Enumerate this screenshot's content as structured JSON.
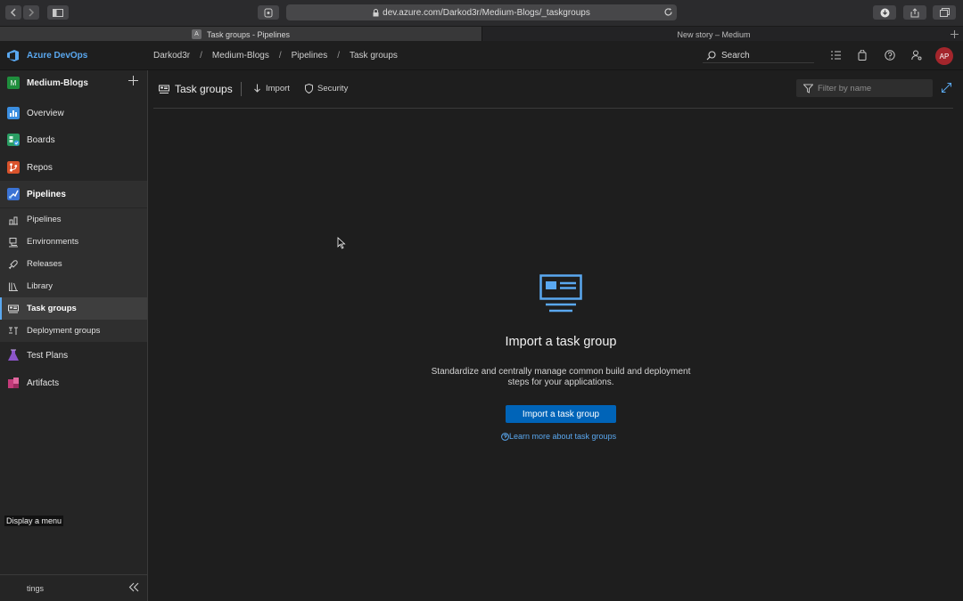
{
  "browser": {
    "url": "dev.azure.com/Darkod3r/Medium-Blogs/_taskgroups",
    "tabs": [
      {
        "label": "Task groups - Pipelines",
        "favicon_letter": "A",
        "active": true
      },
      {
        "label": "New story – Medium",
        "active": false
      }
    ]
  },
  "header": {
    "brand": "Azure DevOps",
    "breadcrumb": [
      "Darkod3r",
      "Medium-Blogs",
      "Pipelines",
      "Task groups"
    ],
    "breadcrumb_separator": "/",
    "search_placeholder": "Search",
    "avatar_initials": "AP",
    "avatar_color": "#a4262c"
  },
  "sidebar": {
    "project_badge": "M",
    "project_name": "Medium-Blogs",
    "items": [
      {
        "label": "Overview",
        "color": "#3b8ee0"
      },
      {
        "label": "Boards",
        "color": "#2a9d63"
      },
      {
        "label": "Repos",
        "color": "#d9532c"
      },
      {
        "label": "Pipelines",
        "color": "#3b73d4"
      },
      {
        "label": "Test Plans",
        "color": "#8b54c9"
      },
      {
        "label": "Artifacts",
        "color": "#c43b7a"
      }
    ],
    "pipelines_sub": [
      {
        "label": "Pipelines"
      },
      {
        "label": "Environments"
      },
      {
        "label": "Releases"
      },
      {
        "label": "Library"
      },
      {
        "label": "Task groups",
        "selected": true
      },
      {
        "label": "Deployment groups"
      }
    ],
    "settings_label": "tings",
    "tooltip": "Display a menu"
  },
  "commandbar": {
    "title": "Task groups",
    "import_label": "Import",
    "security_label": "Security",
    "filter_placeholder": "Filter by name"
  },
  "empty_state": {
    "title": "Import a task group",
    "description": "Standardize and centrally manage common build and deployment steps for your applications.",
    "button_label": "Import a task group",
    "link_label": "Learn more about task groups"
  },
  "colors": {
    "accent": "#5aa8f0",
    "primary_button": "#0064b8"
  }
}
